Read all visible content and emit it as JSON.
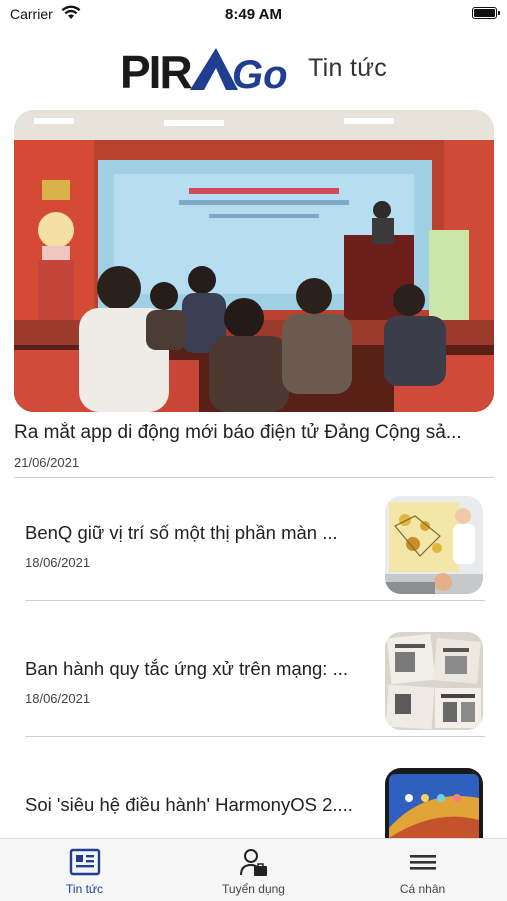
{
  "status_bar": {
    "carrier": "Carrier",
    "time": "8:49 AM"
  },
  "header": {
    "logo_text": "PIRAGO",
    "title": "Tin tức"
  },
  "featured": {
    "title": "Ra mắt app di động mới báo điện tử Đảng Cộng sả...",
    "date": "21/06/2021"
  },
  "news": [
    {
      "title": "BenQ giữ vị trí số một thị phần màn ...",
      "date": "18/06/2021"
    },
    {
      "title": "Ban hành quy tắc ứng xử trên mạng: ...",
      "date": "18/06/2021"
    },
    {
      "title": "Soi 'siêu hệ điều hành' HarmonyOS 2....",
      "date": ""
    }
  ],
  "tabs": [
    {
      "label": "Tin tức",
      "icon": "newspaper-icon",
      "active": true
    },
    {
      "label": "Tuyển dụng",
      "icon": "recruitment-icon",
      "active": false
    },
    {
      "label": "Cá nhân",
      "icon": "menu-icon",
      "active": false
    }
  ],
  "colors": {
    "brand_blue": "#1f3d91",
    "brand_dark": "#1a1a1a",
    "tab_bg": "#f6f6f6"
  }
}
